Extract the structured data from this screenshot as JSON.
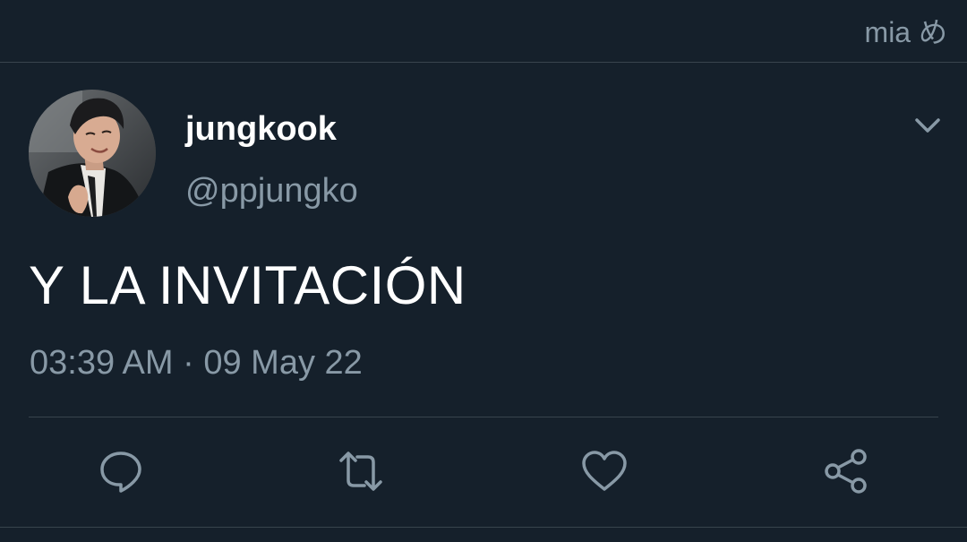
{
  "topbar": {
    "label": "mia め"
  },
  "tweet": {
    "display_name": "jungkook",
    "handle": "@ppjungko",
    "text": "Y LA INVITACIÓN",
    "time": "03:39 AM",
    "separator": "·",
    "date": "09 May 22"
  },
  "icons": {
    "menu": "chevron-down-icon",
    "reply": "reply-icon",
    "retweet": "retweet-icon",
    "like": "heart-icon",
    "share": "share-icon"
  },
  "colors": {
    "background": "#15202b",
    "muted_text": "#8899a6",
    "divider": "#38444d",
    "primary_text": "#ffffff"
  }
}
